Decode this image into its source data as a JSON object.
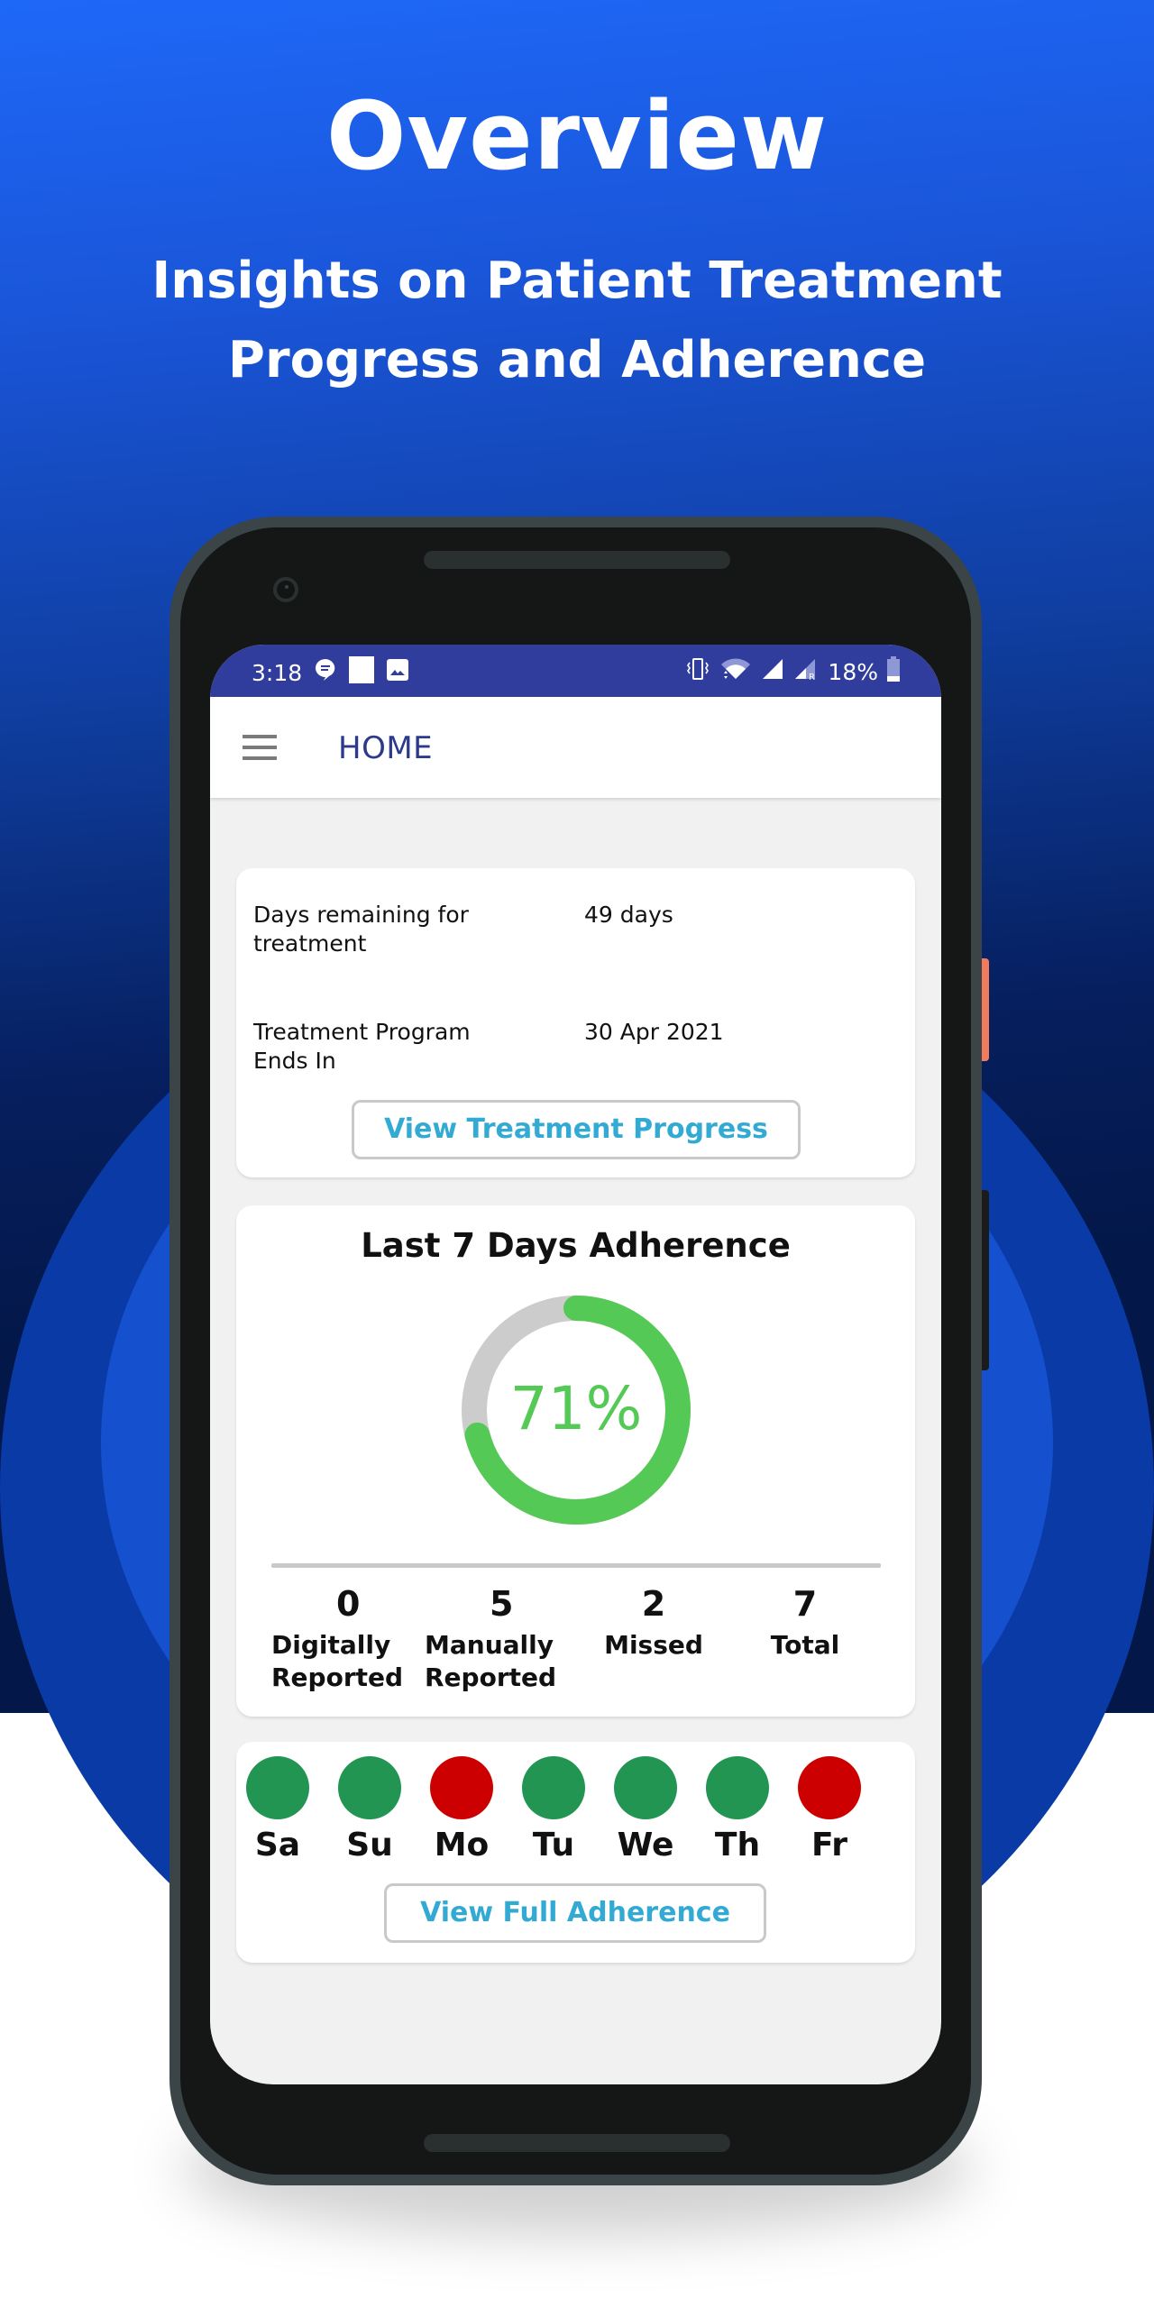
{
  "hero": {
    "title": "Overview",
    "subtitle_lines": [
      "Insights on Patient Treatment",
      "Progress and Adherence"
    ]
  },
  "status_bar": {
    "time": "3:18",
    "battery": "18%",
    "left_icons": [
      "chat-notification-icon",
      "blank-notification-icon",
      "image-notification-icon"
    ],
    "right_icons": [
      "vibrate-icon",
      "wifi-icon",
      "signal-icon",
      "signal-roaming-icon",
      "battery-icon"
    ]
  },
  "app_bar": {
    "menu_icon": "hamburger-menu-icon",
    "title": "HOME"
  },
  "treatment_card": {
    "rows": [
      {
        "label": "Days remaining for treatment",
        "value": "49 days"
      },
      {
        "label": "Treatment Program Ends In",
        "value": "30 Apr 2021"
      }
    ],
    "button_label": "View Treatment Progress"
  },
  "adherence_card": {
    "title": "Last 7 Days Adherence",
    "percent_label": "71%",
    "percent_value": 71,
    "ring_color": "#55c955",
    "ring_track_color": "#cccccc",
    "stats": [
      {
        "value": "0",
        "label": "Digitally Reported"
      },
      {
        "value": "5",
        "label": "Manually Reported"
      },
      {
        "value": "2",
        "label": "Missed"
      },
      {
        "value": "7",
        "label": "Total"
      }
    ]
  },
  "days_card": {
    "days": [
      {
        "label": "Sa",
        "status": "taken"
      },
      {
        "label": "Su",
        "status": "taken"
      },
      {
        "label": "Mo",
        "status": "missed"
      },
      {
        "label": "Tu",
        "status": "taken"
      },
      {
        "label": "We",
        "status": "taken"
      },
      {
        "label": "Th",
        "status": "taken"
      },
      {
        "label": "Fr",
        "status": "missed"
      }
    ],
    "status_colors": {
      "taken": "#229552",
      "missed": "#cc0000"
    },
    "button_label": "View Full Adherence"
  },
  "colors": {
    "accent_link": "#33aad4",
    "status_bar": "#303d9c",
    "app_title": "#2d3a8c"
  }
}
